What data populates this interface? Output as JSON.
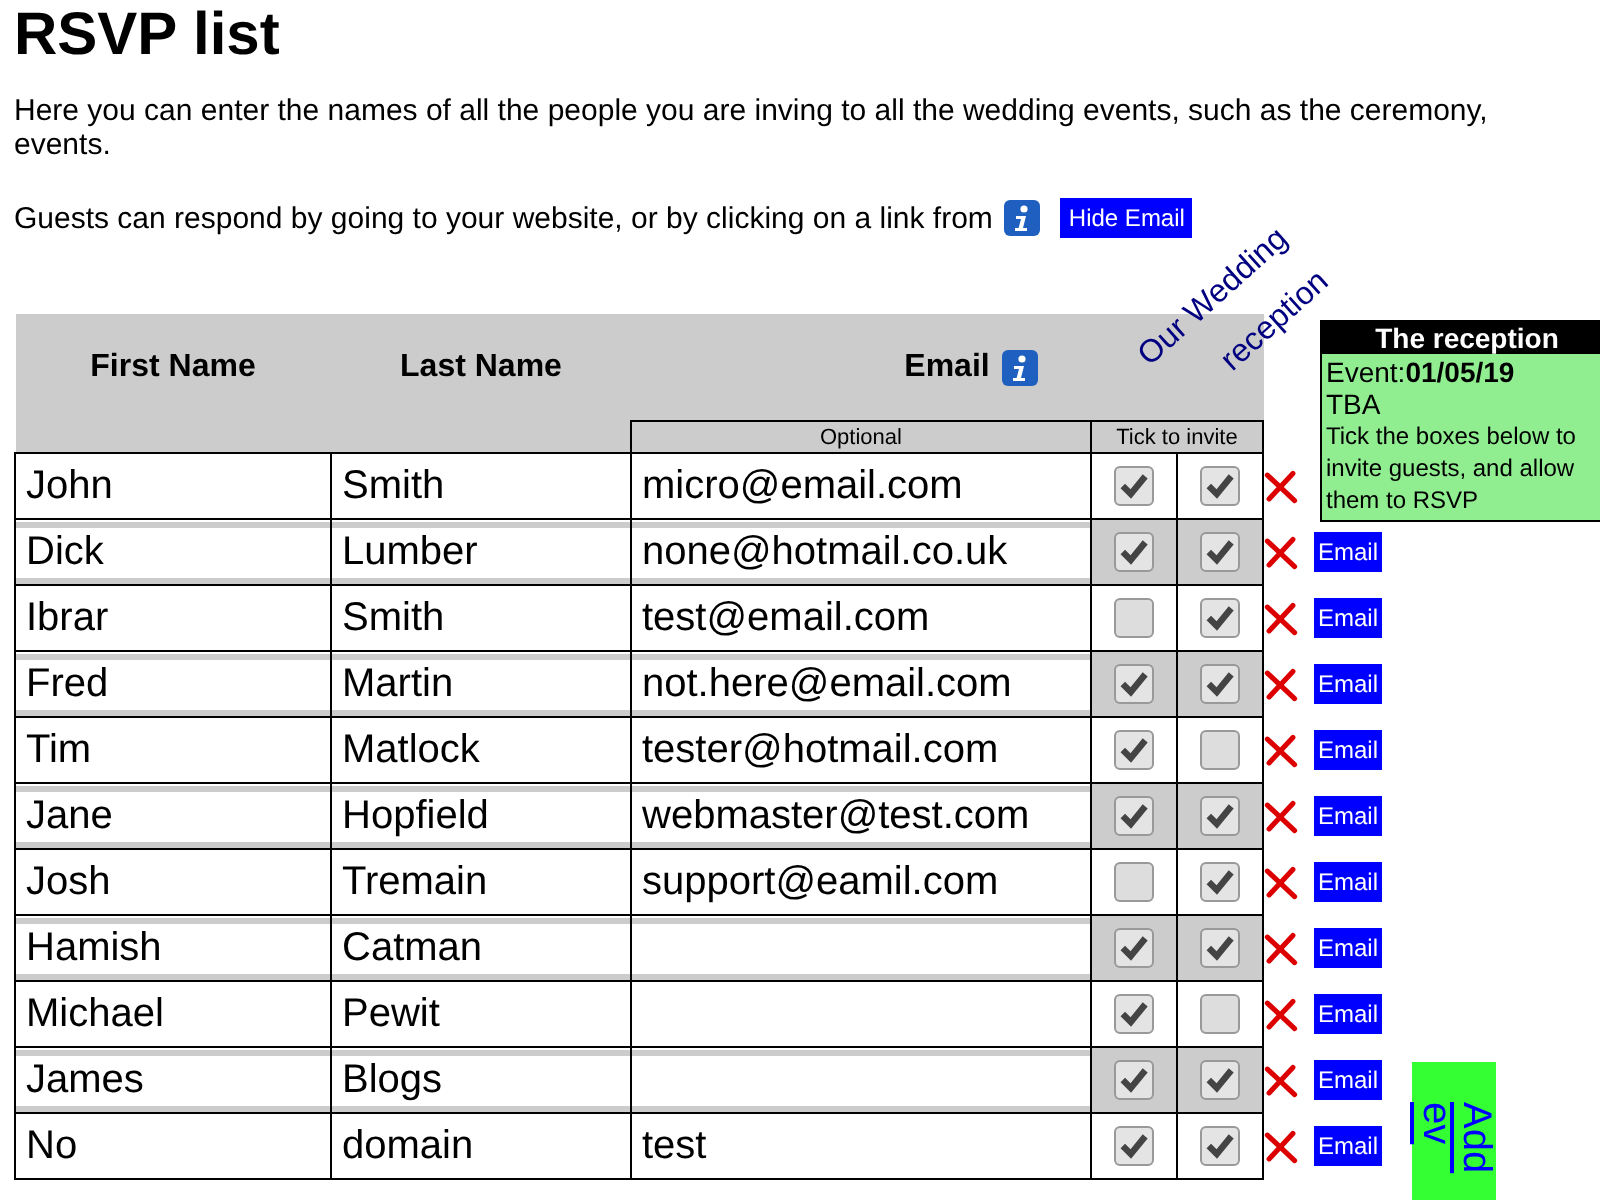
{
  "title": "RSVP list",
  "intro": [
    "Here you can enter the names of all the people you are inving to all the wedding events, such as the ceremony,",
    "events."
  ],
  "guests_note": "Guests can respond by going to your website, or by clicking on a link from",
  "hide_email_button": "Hide Email",
  "table": {
    "columns": [
      "First Name",
      "Last Name",
      "Email"
    ],
    "email_hint": "Optional",
    "tick_hint": "Tick to invite",
    "event_heading": [
      "Our Wedding",
      "reception"
    ],
    "rows": [
      {
        "first": "John",
        "last": "Smith",
        "email": "micro@email.com",
        "invite_1": true,
        "invite_2": true
      },
      {
        "first": "Dick",
        "last": "Lumber",
        "email": "none@hotmail.co.uk",
        "invite_1": true,
        "invite_2": true,
        "email_button": "Email"
      },
      {
        "first": "Ibrar",
        "last": "Smith",
        "email": "test@email.com",
        "invite_1": false,
        "invite_2": true,
        "email_button": "Email"
      },
      {
        "first": "Fred",
        "last": "Martin",
        "email": "not.here@email.com",
        "invite_1": true,
        "invite_2": true,
        "email_button": "Email"
      },
      {
        "first": "Tim",
        "last": "Matlock",
        "email": "tester@hotmail.com",
        "invite_1": true,
        "invite_2": false,
        "email_button": "Email"
      },
      {
        "first": "Jane",
        "last": "Hopfield",
        "email": "webmaster@test.com",
        "invite_1": true,
        "invite_2": true,
        "email_button": "Email"
      },
      {
        "first": "Josh",
        "last": "Tremain",
        "email": "support@eamil.com",
        "invite_1": false,
        "invite_2": true,
        "email_button": "Email"
      },
      {
        "first": "Hamish",
        "last": "Catman",
        "invite_1": true,
        "invite_2": true,
        "email_button": "Email"
      },
      {
        "first": "Michael",
        "last": "Pewit",
        "invite_1": true,
        "invite_2": false,
        "email_button": "Email"
      },
      {
        "first": "James",
        "last": "Blogs",
        "invite_1": true,
        "invite_2": true,
        "email_button": "Email"
      },
      {
        "first": "No",
        "last": "domain",
        "email": "test",
        "invite_1": true,
        "invite_2": true,
        "email_button": "Email"
      }
    ]
  },
  "event_panel": {
    "title": "The reception",
    "event_label": "Event:",
    "date": "01/05/19",
    "venue": "TBA",
    "help": "Tick the boxes below to invite guests, and allow them to RSVP"
  },
  "add_event_button": [
    "Add",
    "ev"
  ]
}
